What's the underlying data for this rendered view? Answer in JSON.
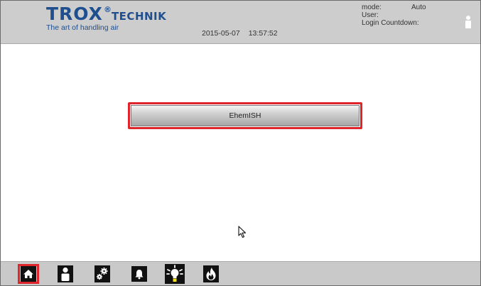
{
  "header": {
    "logo": {
      "word": "TROX",
      "registered": "®",
      "word_small": "TECHNIK",
      "tagline": "The art of handling air"
    },
    "date": "2015-05-07",
    "time": "13:57:52",
    "status": {
      "mode_label": "mode:",
      "mode_value": "Auto",
      "user_label": "User:",
      "user_value": "",
      "countdown_label": "Login Countdown:",
      "countdown_value": ""
    },
    "user_icon": "person-icon"
  },
  "main": {
    "area_button_label": "EhemISH"
  },
  "bottom_nav": [
    {
      "icon": "home-icon",
      "active": true
    },
    {
      "icon": "person-icon",
      "active": false
    },
    {
      "icon": "gears-icon",
      "active": false
    },
    {
      "icon": "bell-icon",
      "active": false
    },
    {
      "icon": "lightbulb-icon",
      "active": false
    },
    {
      "icon": "flame-icon",
      "active": false
    }
  ],
  "colors": {
    "highlight": "#e0242c",
    "brand": "#1f4f8f",
    "bar": "#c9c9c9"
  }
}
